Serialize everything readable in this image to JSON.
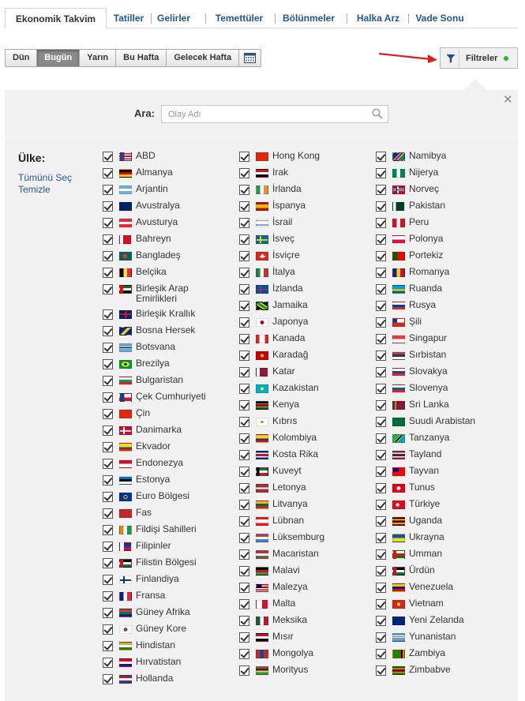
{
  "tabs": [
    {
      "label": "Ekonomik Takvim",
      "active": true
    },
    {
      "label": "Tatiller"
    },
    {
      "label": "Gelirler"
    },
    {
      "label": "Temettüler"
    },
    {
      "label": "Bölünmeler"
    },
    {
      "label": "Halka Arz"
    },
    {
      "label": "Vade Sonu"
    }
  ],
  "date_buttons": [
    {
      "label": "Dün"
    },
    {
      "label": "Bugün",
      "active": true
    },
    {
      "label": "Yarın"
    },
    {
      "label": "Bu Hafta"
    },
    {
      "label": "Gelecek Hafta"
    }
  ],
  "filter": {
    "label": "Filtreler",
    "status_color": "#2db52d"
  },
  "search": {
    "label": "Ara:",
    "placeholder": "Olay Adı"
  },
  "country": {
    "label": "Ülke:",
    "select_all": "Tümünü Seç",
    "clear": "Temizle"
  },
  "colors": {
    "link": "#1f5796",
    "panel": "#f1f1f1",
    "arrow": "#e01b1b"
  },
  "countries": [
    [
      {
        "name": "ABD",
        "flag": "linear-gradient(90deg,#3c3b6e 0 40%,transparent 40%),repeating-linear-gradient(#b22234 0 1.6px,#fff 1.6px 3.2px)"
      },
      {
        "name": "Almanya",
        "flag": "linear-gradient(#000 0 33%,#dd0000 33% 66%,#ffce00 66%)"
      },
      {
        "name": "Arjantin",
        "flag": "linear-gradient(#74acdf 0 33%,#fff 33% 66%,#74acdf 66%)"
      },
      {
        "name": "Avustralya",
        "flag": "linear-gradient(#012169,#012169)"
      },
      {
        "name": "Avusturya",
        "flag": "linear-gradient(#ed2939 0 33%,#fff 33% 66%,#ed2939 66%)"
      },
      {
        "name": "Bahreyn",
        "flag": "linear-gradient(90deg,#fff 0 30%,#ce1126 30%)"
      },
      {
        "name": "Bangladeş",
        "flag": "radial-gradient(circle at 45% 50%,#f42a41 0 30%,#006a4e 31%)"
      },
      {
        "name": "Belçika",
        "flag": "linear-gradient(90deg,#000 0 33%,#fae042 33% 66%,#ed2939 66%)"
      },
      {
        "name": "Birleşik Arap Emirlikleri",
        "flag": "linear-gradient(90deg,#ff0000 0 28%,transparent 28%),linear-gradient(#00732f 0 33%,#fff 33% 66%,#000 66%)"
      },
      {
        "name": "Birleşik Krallık",
        "flag": "linear-gradient(#c8102e,#c8102e) center/100% 24% no-repeat,linear-gradient(90deg,#c8102e,#c8102e) center/18% 100% no-repeat,linear-gradient(#012169,#012169)"
      },
      {
        "name": "Bosna Hersek",
        "flag": "linear-gradient(135deg,#002395 0 40%,#fecb00 40% 62%,#002395 62%)"
      },
      {
        "name": "Botsvana",
        "flag": "linear-gradient(#6da9d2 0 38%,#fff 38% 42%,#000 42% 58%,#fff 58% 62%,#6da9d2 62%)"
      },
      {
        "name": "Brezilya",
        "flag": "radial-gradient(ellipse at center,#002776 0 22%,#fedf00 23% 48%,#009c3b 49%)"
      },
      {
        "name": "Bulgaristan",
        "flag": "linear-gradient(#fff 0 33%,#00966e 33% 66%,#d62612 66%)"
      },
      {
        "name": "Çek Cumhuriyeti",
        "flag": "linear-gradient(90deg,#11457e 0 40%,transparent 40%),linear-gradient(#fff 0 50%,#d7141a 50%)"
      },
      {
        "name": "Çin",
        "flag": "linear-gradient(#de2910,#de2910)"
      },
      {
        "name": "Danimarka",
        "flag": "linear-gradient(#fff,#fff) center/100% 20% no-repeat,linear-gradient(90deg,#fff,#fff) 35% 0/14% 100% no-repeat,linear-gradient(#c60c30,#c60c30)"
      },
      {
        "name": "Ekvador",
        "flag": "linear-gradient(#ffdd00 0 50%,#034ea2 50% 75%,#ed1c24 75%)"
      },
      {
        "name": "Endonezya",
        "flag": "linear-gradient(#ce1126 0 50%,#fff 50%)"
      },
      {
        "name": "Estonya",
        "flag": "linear-gradient(#0072ce 0 33%,#000 33% 66%,#fff 66%)"
      },
      {
        "name": "Euro Bölgesi",
        "flag": "radial-gradient(circle,#003399 0 20%,#ffcc00 22% 30%,#003399 32%)"
      },
      {
        "name": "Fas",
        "flag": "linear-gradient(#c1272d,#c1272d)"
      },
      {
        "name": "Fildişi Sahilleri",
        "flag": "linear-gradient(90deg,#f77f00 0 33%,#fff 33% 66%,#009e60 66%)"
      },
      {
        "name": "Filipinler",
        "flag": "linear-gradient(90deg,#fff 0 35%,transparent 35%),linear-gradient(#0038a8 0 50%,#ce1126 50%)"
      },
      {
        "name": "Filistin Bölgesi",
        "flag": "linear-gradient(90deg,#ce1126 0 30%,transparent 30%),linear-gradient(#000 0 33%,#fff 33% 66%,#007a3d 66%)"
      },
      {
        "name": "Finlandiya",
        "flag": "linear-gradient(#003580,#003580) center/100% 22% no-repeat,linear-gradient(90deg,#003580,#003580) 35% 0/15% 100% no-repeat,linear-gradient(#fff,#fff)"
      },
      {
        "name": "Fransa",
        "flag": "linear-gradient(90deg,#002395 0 33%,#fff 33% 66%,#ed2939 66%)"
      },
      {
        "name": "Güney Afrika",
        "flag": "linear-gradient(#de3831 0 33%,#007a4d 33% 66%,#002395 66%)"
      },
      {
        "name": "Güney Kore",
        "flag": "radial-gradient(circle,#cd2e3a 0 22%,#0047a0 23% 28%,#fff 29%)"
      },
      {
        "name": "Hindistan",
        "flag": "linear-gradient(#ff9933 0 33%,#fff 33% 66%,#138808 66%)"
      },
      {
        "name": "Hırvatistan",
        "flag": "linear-gradient(#ff0000 0 33%,#fff 33% 66%,#171796 66%)"
      },
      {
        "name": "Hollanda",
        "flag": "linear-gradient(#ae1c28 0 33%,#fff 33% 66%,#21468b 66%)"
      }
    ],
    [
      {
        "name": "Hong Kong",
        "flag": "linear-gradient(#de2910,#de2910)"
      },
      {
        "name": "Irak",
        "flag": "linear-gradient(#ce1126 0 33%,#fff 33% 66%,#000 66%)"
      },
      {
        "name": "İrlanda",
        "flag": "linear-gradient(90deg,#169b62 0 33%,#fff 33% 66%,#ff883e 66%)"
      },
      {
        "name": "İspanya",
        "flag": "linear-gradient(#aa151b 0 25%,#f1bf00 25% 75%,#aa151b 75%)"
      },
      {
        "name": "İsrail",
        "flag": "linear-gradient(#fff 0 15%,#0038b8 15% 25%,#fff 25% 75%,#0038b8 75% 85%,#fff 85%)"
      },
      {
        "name": "İsveç",
        "flag": "linear-gradient(#fecc00,#fecc00) center/100% 22% no-repeat,linear-gradient(90deg,#fecc00,#fecc00) 35% 0/15% 100% no-repeat,linear-gradient(#006aa7,#006aa7)"
      },
      {
        "name": "İsviçre",
        "flag": "linear-gradient(#fff,#fff) center/50% 18% no-repeat,linear-gradient(90deg,#fff,#fff) center/18% 60% no-repeat,linear-gradient(#d52b1e,#d52b1e)"
      },
      {
        "name": "İtalya",
        "flag": "linear-gradient(90deg,#009246 0 33%,#fff 33% 66%,#ce2b37 66%)"
      },
      {
        "name": "İzlanda",
        "flag": "linear-gradient(#dc1e35,#dc1e35) center/100% 16% no-repeat,linear-gradient(90deg,#dc1e35,#dc1e35) 35% 0/11% 100% no-repeat,linear-gradient(#02529c,#02529c)"
      },
      {
        "name": "Jamaika",
        "flag": "linear-gradient(33deg,#000 0 30%,#fed100 30% 40%,#009b3a 40% 60%,#fed100 60% 70%,#000 70%)"
      },
      {
        "name": "Japonya",
        "flag": "radial-gradient(circle,#bc002d 0 28%,#fff 30%)"
      },
      {
        "name": "Kanada",
        "flag": "linear-gradient(90deg,#d52b1e 0 25%,#fff 25% 75%,#d52b1e 75%)"
      },
      {
        "name": "Karadağ",
        "flag": "radial-gradient(circle,#d4af37 0 25%,#c40308 27%)"
      },
      {
        "name": "Katar",
        "flag": "linear-gradient(90deg,#fff 0 30%,#8d1b3d 30%)"
      },
      {
        "name": "Kazakistan",
        "flag": "radial-gradient(circle,#ffec2d 0 22%,#00afca 24%)"
      },
      {
        "name": "Kenya",
        "flag": "linear-gradient(#000 0 30%,#fff 30% 35%,#bb0000 35% 65%,#fff 65% 70%,#006600 70%)"
      },
      {
        "name": "Kıbrıs",
        "flag": "radial-gradient(ellipse,#d57800 0 20%,#fff 22%)"
      },
      {
        "name": "Kolombiya",
        "flag": "linear-gradient(#fcd116 0 50%,#003893 50% 75%,#ce1126 75%)"
      },
      {
        "name": "Kosta Rika",
        "flag": "linear-gradient(#002b7f 0 17%,#fff 17% 33%,#ce1126 33% 67%,#fff 67% 83%,#002b7f 83%)"
      },
      {
        "name": "Kuveyt",
        "flag": "linear-gradient(90deg,#000 0 25%,transparent 25%),linear-gradient(#007a3d 0 33%,#fff 33% 66%,#ce1126 66%)"
      },
      {
        "name": "Letonya",
        "flag": "linear-gradient(#9e3039 0 40%,#fff 40% 60%,#9e3039 60%)"
      },
      {
        "name": "Litvanya",
        "flag": "linear-gradient(#fdb913 0 33%,#006a44 33% 66%,#c1272d 66%)"
      },
      {
        "name": "Lübnan",
        "flag": "linear-gradient(#ed1c24 0 25%,#fff 25% 75%,#ed1c24 75%)"
      },
      {
        "name": "Lüksemburg",
        "flag": "linear-gradient(#ed2939 0 33%,#fff 33% 66%,#00a1de 66%)"
      },
      {
        "name": "Macaristan",
        "flag": "linear-gradient(#ce2939 0 33%,#fff 33% 66%,#477050 66%)"
      },
      {
        "name": "Malavi",
        "flag": "linear-gradient(#000 0 33%,#ce1126 33% 66%,#339e35 66%)"
      },
      {
        "name": "Malezya",
        "flag": "linear-gradient(90deg,#010066 0 45%,transparent 45%) top/100% 55% no-repeat,repeating-linear-gradient(#cc0001 0 1.6px,#fff 1.6px 3.2px)"
      },
      {
        "name": "Malta",
        "flag": "linear-gradient(90deg,#fff 0 50%,#cf142b 50%)"
      },
      {
        "name": "Meksika",
        "flag": "linear-gradient(90deg,#006847 0 33%,#fff 33% 66%,#ce1126 66%)"
      },
      {
        "name": "Mısır",
        "flag": "linear-gradient(#ce1126 0 33%,#fff 33% 66%,#000 66%)"
      },
      {
        "name": "Mongolya",
        "flag": "linear-gradient(90deg,#c4272f 0 33%,#015197 33% 66%,#c4272f 66%)"
      },
      {
        "name": "Morityus",
        "flag": "linear-gradient(#ea2839 0 25%,#1a206d 25% 50%,#ffd500 50% 75%,#00a551 75%)"
      }
    ],
    [
      {
        "name": "Namibya",
        "flag": "linear-gradient(135deg,#003580 0 38%,#fff 38% 42%,#d21034 42% 58%,#fff 58% 62%,#009543 62%)"
      },
      {
        "name": "Nijerya",
        "flag": "linear-gradient(90deg,#008751 0 33%,#fff 33% 66%,#008751 66%)"
      },
      {
        "name": "Norveç",
        "flag": "linear-gradient(#00205b,#00205b) center/100% 14% no-repeat,linear-gradient(90deg,#00205b,#00205b) 35% 0/10% 100% no-repeat,linear-gradient(#fff,#fff) center/100% 30% no-repeat,linear-gradient(90deg,#fff,#fff) 35% 0/20% 100% no-repeat,linear-gradient(#ba0c2f,#ba0c2f)"
      },
      {
        "name": "Pakistan",
        "flag": "linear-gradient(90deg,#fff 0 25%,#01411c 25%)"
      },
      {
        "name": "Peru",
        "flag": "linear-gradient(90deg,#d91023 0 33%,#fff 33% 66%,#d91023 66%)"
      },
      {
        "name": "Polonya",
        "flag": "linear-gradient(#fff 0 50%,#dc143c 50%)"
      },
      {
        "name": "Portekiz",
        "flag": "linear-gradient(90deg,#006600 0 40%,#ff0000 40%)"
      },
      {
        "name": "Romanya",
        "flag": "linear-gradient(90deg,#002b7f 0 33%,#fcd116 33% 66%,#ce1126 66%)"
      },
      {
        "name": "Ruanda",
        "flag": "linear-gradient(#00a1de 0 50%,#fad201 50% 75%,#20603d 75%)"
      },
      {
        "name": "Rusya",
        "flag": "linear-gradient(#fff 0 33%,#0039a6 33% 66%,#d52b1e 66%)"
      },
      {
        "name": "Şili",
        "flag": "linear-gradient(90deg,#0039a6 0 35%,#fff 35%) top/100% 50% no-repeat,linear-gradient(#d52b1e,#d52b1e)"
      },
      {
        "name": "Singapur",
        "flag": "linear-gradient(#ef3340 0 50%,#fff 50%)"
      },
      {
        "name": "Sırbistan",
        "flag": "linear-gradient(#c6363c 0 33%,#0c4076 33% 66%,#fff 66%)"
      },
      {
        "name": "Slovakya",
        "flag": "linear-gradient(#fff 0 33%,#0b4ea2 33% 66%,#ee1c25 66%)"
      },
      {
        "name": "Slovenya",
        "flag": "linear-gradient(#fff 0 33%,#005da4 33% 66%,#ed1c24 66%)"
      },
      {
        "name": "Sri Lanka",
        "flag": "linear-gradient(90deg,#00534e 0 15%,#eb7400 15% 30%,#8d153a 30%)"
      },
      {
        "name": "Suudi Arabistan",
        "flag": "linear-gradient(#006c35,#006c35)"
      },
      {
        "name": "Tanzanya",
        "flag": "linear-gradient(135deg,#1eb53a 0 40%,#fcd116 40% 44%,#000 44% 56%,#fcd116 56% 60%,#00a3dd 60%)"
      },
      {
        "name": "Tayland",
        "flag": "linear-gradient(#a51931 0 17%,#f4f5f8 17% 33%,#2d2a4a 33% 67%,#f4f5f8 67% 83%,#a51931 83%)"
      },
      {
        "name": "Tayvan",
        "flag": "linear-gradient(90deg,#000095 0 50%,transparent 50%) top/100% 50% no-repeat,linear-gradient(#fe0000,#fe0000)"
      },
      {
        "name": "Tunus",
        "flag": "radial-gradient(circle,#fff 0 28%,#e70013 30%)"
      },
      {
        "name": "Türkiye",
        "flag": "radial-gradient(circle at 40% 50%,#fff 0 22%,#e30a17 24%)"
      },
      {
        "name": "Uganda",
        "flag": "linear-gradient(#000 0 17%,#fcdc04 17% 33%,#d90000 33% 50%,#000 50% 67%,#fcdc04 67% 83%,#d90000 83%)"
      },
      {
        "name": "Ukrayna",
        "flag": "linear-gradient(#0057b7 0 50%,#ffd700 50%)"
      },
      {
        "name": "Umman",
        "flag": "linear-gradient(90deg,#db161b 0 30%,transparent 30%),linear-gradient(#fff 0 33%,#db161b 33% 66%,#008000 66%)"
      },
      {
        "name": "Ürdün",
        "flag": "linear-gradient(90deg,#ce1126 0 30%,transparent 30%),linear-gradient(#000 0 33%,#fff 33% 66%,#007a3d 66%)"
      },
      {
        "name": "Venezuela",
        "flag": "linear-gradient(#ffcc00 0 33%,#00247d 33% 66%,#cf142b 66%)"
      },
      {
        "name": "Vietnam",
        "flag": "radial-gradient(circle,#ffff00 0 22%,#da251d 24%)"
      },
      {
        "name": "Yeni Zelanda",
        "flag": "linear-gradient(#00247d,#00247d)"
      },
      {
        "name": "Yunanistan",
        "flag": "repeating-linear-gradient(#0d5eaf 0 1.2px,#fff 1.2px 2.4px)"
      },
      {
        "name": "Zambiya",
        "flag": "linear-gradient(90deg,#198a00 0 60%,#de2010 60% 73%,#000 73% 86%,#ef7d00 86%)"
      },
      {
        "name": "Zimbabve",
        "flag": "linear-gradient(#006400 0 14%,#ffd200 14% 28%,#d40000 28% 43%,#000 43% 57%,#d40000 57% 71%,#ffd200 71% 86%,#006400 86%)"
      }
    ]
  ]
}
